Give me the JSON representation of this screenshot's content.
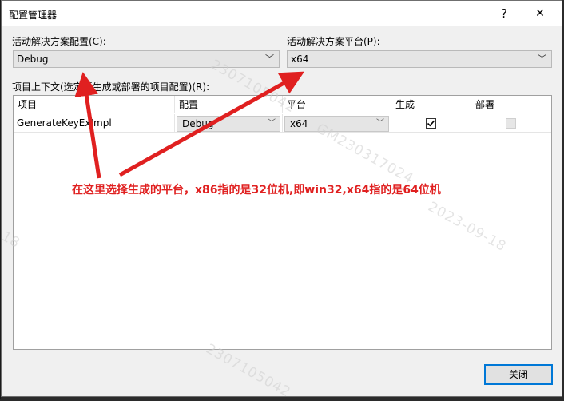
{
  "window": {
    "title": "配置管理器",
    "help_label": "?",
    "close_label": "✕"
  },
  "config_label": "活动解决方案配置(C):",
  "config_value": "Debug",
  "platform_label": "活动解决方案平台(P):",
  "platform_value": "x64",
  "context_label": "项目上下文(选定要生成或部署的项目配置)(R):",
  "columns": {
    "project": "项目",
    "config": "配置",
    "platform": "平台",
    "build": "生成",
    "deploy": "部署"
  },
  "row": {
    "project": "GenerateKeyExImpl",
    "config": "Debug",
    "platform": "x64",
    "build": true,
    "deploy": false
  },
  "close_button": "关闭",
  "annotation": "在这里选择生成的平台，x86指的是32位机,即win32,x64指的是64位机",
  "watermarks": [
    "2307105042",
    "GM230317024",
    "2023-09-18",
    "18",
    "2307105042"
  ],
  "icons": {
    "chevron": "chevron-down-icon",
    "check": "check-icon"
  },
  "colors": {
    "annotation": "#e02020",
    "accent": "#0078d7"
  }
}
